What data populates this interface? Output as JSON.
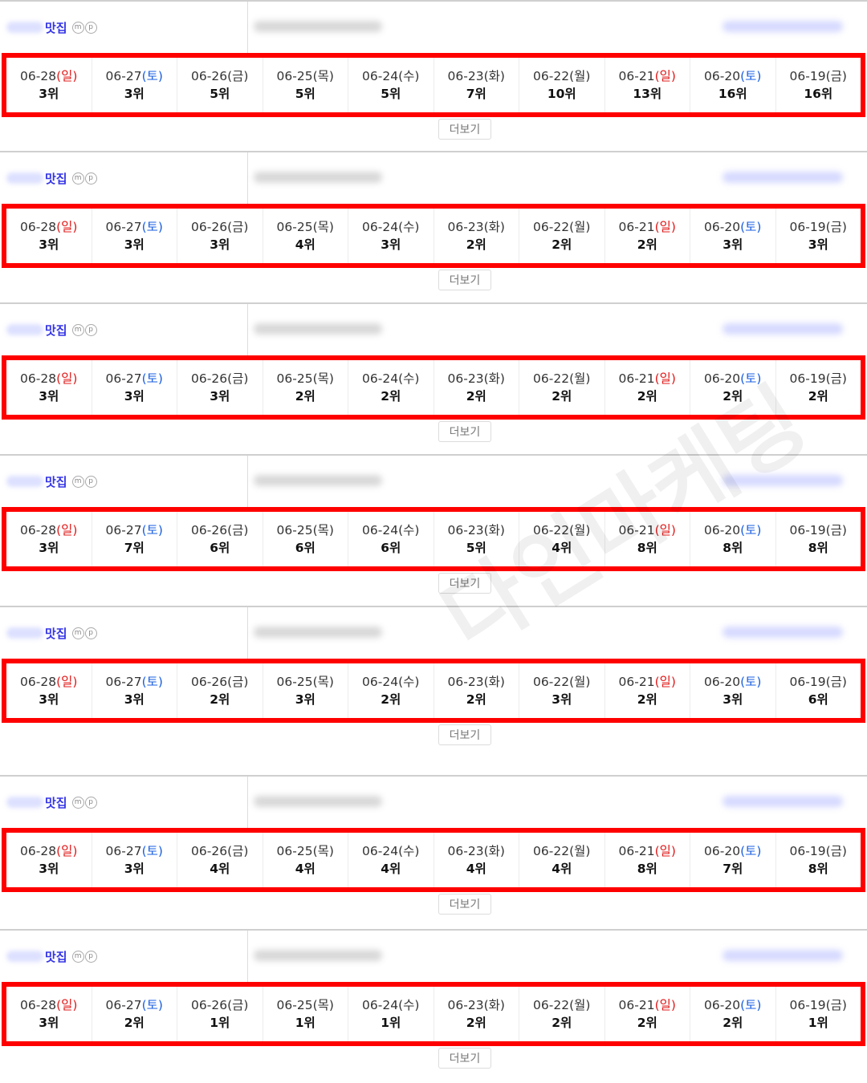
{
  "colors": {
    "sun": "#e21b1b",
    "sat": "#1a5fe0",
    "weekday": "#333333",
    "highlight": "#ff0000",
    "keyword": "#3535e6"
  },
  "header_icons": [
    "m-icon",
    "p-icon"
  ],
  "more_label": "더보기",
  "blocks": [
    {
      "keyword": "맛집",
      "dates": [
        "06-28",
        "06-27",
        "06-26",
        "06-25",
        "06-24",
        "06-23",
        "06-22",
        "06-21",
        "06-20",
        "06-19"
      ],
      "days": [
        "일",
        "토",
        "금",
        "목",
        "수",
        "화",
        "월",
        "일",
        "토",
        "금"
      ],
      "ranks": [
        "3위",
        "3위",
        "5위",
        "5위",
        "5위",
        "7위",
        "10위",
        "13위",
        "16위",
        "16위"
      ]
    },
    {
      "keyword": "맛집",
      "dates": [
        "06-28",
        "06-27",
        "06-26",
        "06-25",
        "06-24",
        "06-23",
        "06-22",
        "06-21",
        "06-20",
        "06-19"
      ],
      "days": [
        "일",
        "토",
        "금",
        "목",
        "수",
        "화",
        "월",
        "일",
        "토",
        "금"
      ],
      "ranks": [
        "3위",
        "3위",
        "3위",
        "4위",
        "3위",
        "2위",
        "2위",
        "2위",
        "3위",
        "3위"
      ]
    },
    {
      "keyword": "맛집",
      "dates": [
        "06-28",
        "06-27",
        "06-26",
        "06-25",
        "06-24",
        "06-23",
        "06-22",
        "06-21",
        "06-20",
        "06-19"
      ],
      "days": [
        "일",
        "토",
        "금",
        "목",
        "수",
        "화",
        "월",
        "일",
        "토",
        "금"
      ],
      "ranks": [
        "3위",
        "3위",
        "3위",
        "2위",
        "2위",
        "2위",
        "2위",
        "2위",
        "2위",
        "2위"
      ]
    },
    {
      "keyword": "맛집",
      "dates": [
        "06-28",
        "06-27",
        "06-26",
        "06-25",
        "06-24",
        "06-23",
        "06-22",
        "06-21",
        "06-20",
        "06-19"
      ],
      "days": [
        "일",
        "토",
        "금",
        "목",
        "수",
        "화",
        "월",
        "일",
        "토",
        "금"
      ],
      "ranks": [
        "3위",
        "7위",
        "6위",
        "6위",
        "6위",
        "5위",
        "4위",
        "8위",
        "8위",
        "8위"
      ]
    },
    {
      "keyword": "맛집",
      "dates": [
        "06-28",
        "06-27",
        "06-26",
        "06-25",
        "06-24",
        "06-23",
        "06-22",
        "06-21",
        "06-20",
        "06-19"
      ],
      "days": [
        "일",
        "토",
        "금",
        "목",
        "수",
        "화",
        "월",
        "일",
        "토",
        "금"
      ],
      "ranks": [
        "3위",
        "3위",
        "2위",
        "3위",
        "2위",
        "2위",
        "3위",
        "2위",
        "3위",
        "6위"
      ]
    },
    {
      "keyword": "맛집",
      "dates": [
        "06-28",
        "06-27",
        "06-26",
        "06-25",
        "06-24",
        "06-23",
        "06-22",
        "06-21",
        "06-20",
        "06-19"
      ],
      "days": [
        "일",
        "토",
        "금",
        "목",
        "수",
        "화",
        "월",
        "일",
        "토",
        "금"
      ],
      "ranks": [
        "3위",
        "3위",
        "4위",
        "4위",
        "4위",
        "4위",
        "4위",
        "8위",
        "7위",
        "8위"
      ]
    },
    {
      "keyword": "맛집",
      "dates": [
        "06-28",
        "06-27",
        "06-26",
        "06-25",
        "06-24",
        "06-23",
        "06-22",
        "06-21",
        "06-20",
        "06-19"
      ],
      "days": [
        "일",
        "토",
        "금",
        "목",
        "수",
        "화",
        "월",
        "일",
        "토",
        "금"
      ],
      "ranks": [
        "3위",
        "2위",
        "1위",
        "1위",
        "1위",
        "2위",
        "2위",
        "2위",
        "2위",
        "1위"
      ]
    }
  ]
}
